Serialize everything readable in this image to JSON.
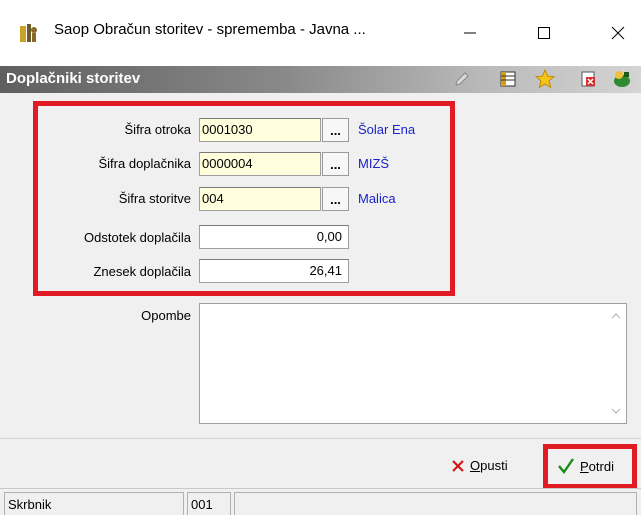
{
  "window": {
    "title": "Saop Obračun storitev - sprememba - Javna ...",
    "minimize_glyph": "—",
    "maximize_glyph": "☐",
    "close_glyph": "✕"
  },
  "header": {
    "title": "Doplačniki storitev",
    "icons": [
      "edit-icon",
      "columns-icon",
      "star-icon",
      "delete-icon",
      "exit-icon"
    ]
  },
  "form": {
    "fields": [
      {
        "label": "Šifra otroka",
        "value": "0001030",
        "lookup": "...",
        "link": "Šolar Ena"
      },
      {
        "label": "Šifra doplačnika",
        "value": "0000004",
        "lookup": "...",
        "link": "MIZŠ"
      },
      {
        "label": "Šifra storitve",
        "value": "004",
        "lookup": "...",
        "link": "Malica"
      },
      {
        "label": "Odstotek doplačila",
        "value": "0,00"
      },
      {
        "label": "Znesek doplačila",
        "value": "26,41"
      }
    ],
    "notes_label": "Opombe",
    "notes_value": ""
  },
  "buttons": {
    "cancel": {
      "underline": "O",
      "rest": "pusti"
    },
    "confirm": {
      "underline": "P",
      "rest": "otrdi"
    }
  },
  "statusbar": {
    "cell1": "Skrbnik",
    "cell2": "001",
    "cell3": ""
  },
  "colors": {
    "highlight": "#e01b24",
    "link": "#1a22cc",
    "input_required": "#ffffdd"
  }
}
